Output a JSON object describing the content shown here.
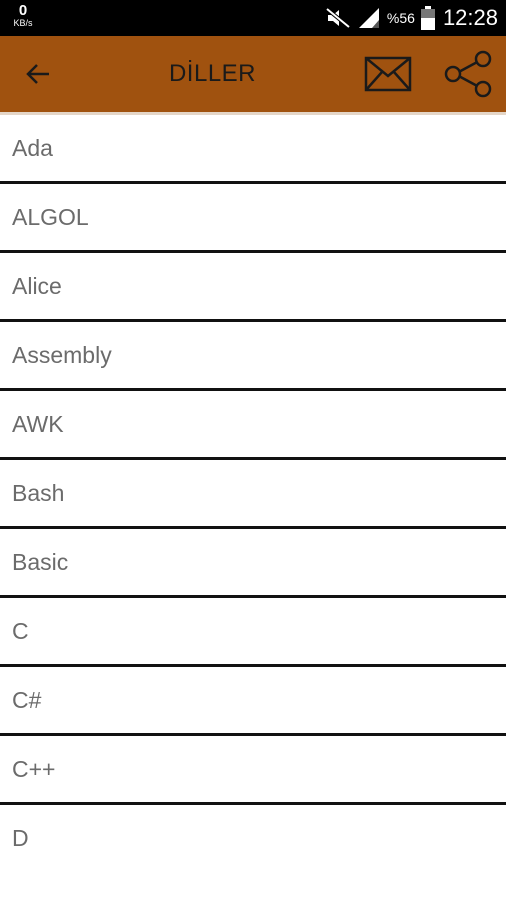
{
  "status_bar": {
    "net_speed_value": "0",
    "net_speed_unit": "KB/s",
    "battery": "%56",
    "time": "12:28",
    "icons": [
      "mute-icon",
      "signal-icon",
      "battery-icon"
    ]
  },
  "app_bar": {
    "title": "DİLLER",
    "background": "#a0520f",
    "icons": [
      "back-arrow-icon",
      "mail-icon",
      "share-icon"
    ]
  },
  "languages": [
    "Ada",
    "ALGOL",
    "Alice",
    "Assembly",
    "AWK",
    "Bash",
    "Basic",
    "C",
    "C#",
    "C++",
    "D"
  ]
}
